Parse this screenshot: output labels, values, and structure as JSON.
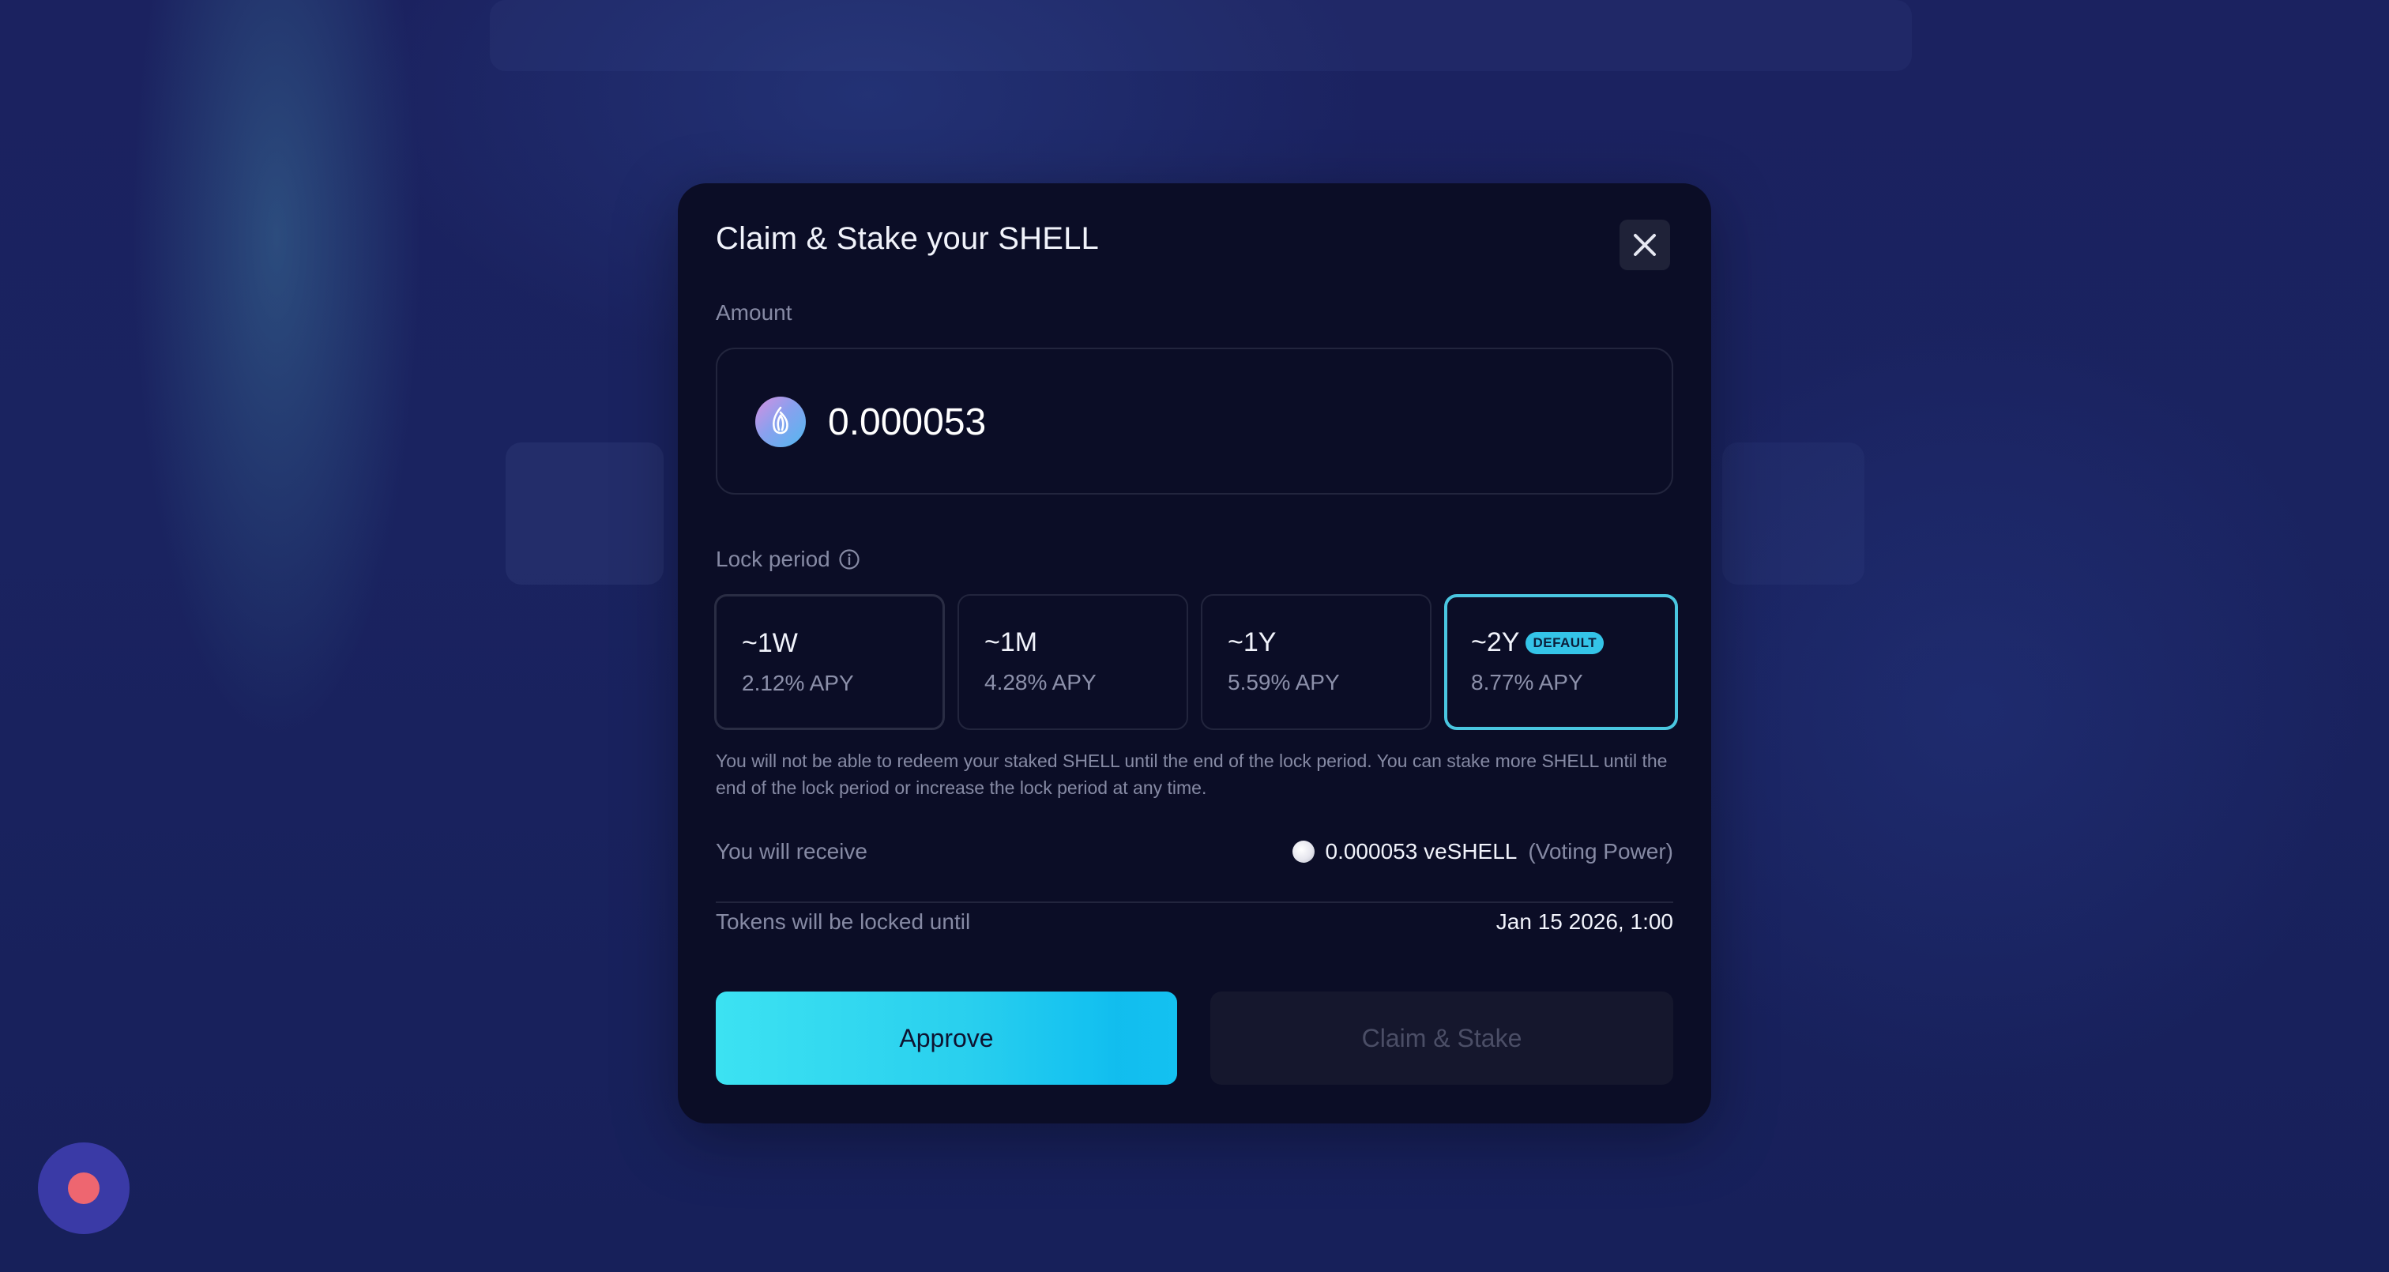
{
  "modal": {
    "title": "Claim & Stake your SHELL",
    "close_icon": "close-icon"
  },
  "amount": {
    "label": "Amount",
    "value": "0.000053",
    "token_icon": "shell-token-icon"
  },
  "lock_period": {
    "label": "Lock period",
    "info_icon": "info-icon",
    "options": [
      {
        "name": "~1W",
        "apy": "2.12% APY",
        "selected": false
      },
      {
        "name": "~1M",
        "apy": "4.28% APY",
        "selected": false
      },
      {
        "name": "~1Y",
        "apy": "5.59% APY",
        "selected": false
      },
      {
        "name": "~2Y",
        "apy": "8.77% APY",
        "selected": true,
        "badge": "DEFAULT"
      }
    ],
    "note": "You will not be able to redeem your staked SHELL until the end of the lock period. You can stake more SHELL until the end of the lock period or increase the lock period at any time."
  },
  "summary": {
    "receive_label": "You will receive",
    "receive_value": "0.000053 veSHELL",
    "receive_suffix": "(Voting Power)",
    "locked_until_label": "Tokens will be locked until",
    "locked_until_value": "Jan 15 2026, 1:00"
  },
  "buttons": {
    "approve": "Approve",
    "claim_stake": "Claim & Stake"
  },
  "colors": {
    "accent": "#34c4e8",
    "modal_bg": "#0b0d26",
    "chat_button": "#3a3aa6",
    "chat_dot": "#ee6670"
  }
}
